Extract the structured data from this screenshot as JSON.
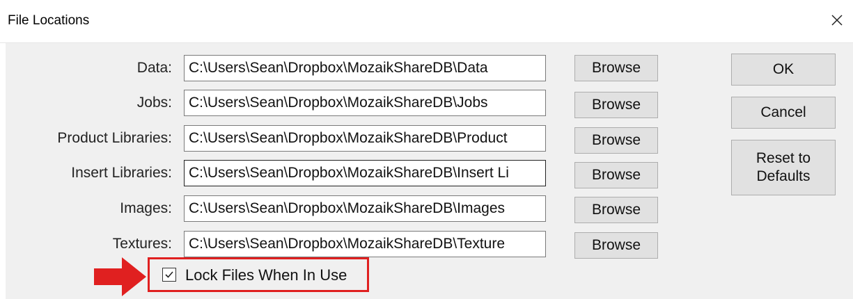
{
  "window": {
    "title": "File Locations"
  },
  "rows": [
    {
      "label": "Data:",
      "path": "C:\\Users\\Sean\\Dropbox\\MozaikShareDB\\Data",
      "browse_label": "Browse"
    },
    {
      "label": "Jobs:",
      "path": "C:\\Users\\Sean\\Dropbox\\MozaikShareDB\\Jobs",
      "browse_label": "Browse"
    },
    {
      "label": "Product Libraries:",
      "path": "C:\\Users\\Sean\\Dropbox\\MozaikShareDB\\Product",
      "browse_label": "Browse"
    },
    {
      "label": "Insert Libraries:",
      "path": "C:\\Users\\Sean\\Dropbox\\MozaikShareDB\\Insert Li",
      "browse_label": "Browse"
    },
    {
      "label": "Images:",
      "path": "C:\\Users\\Sean\\Dropbox\\MozaikShareDB\\Images",
      "browse_label": "Browse"
    },
    {
      "label": "Textures:",
      "path": "C:\\Users\\Sean\\Dropbox\\MozaikShareDB\\Texture",
      "browse_label": "Browse"
    }
  ],
  "actions": {
    "ok_label": "OK",
    "cancel_label": "Cancel",
    "reset_label_line1": "Reset to",
    "reset_label_line2": "Defaults"
  },
  "lock_files": {
    "label": "Lock Files When In Use",
    "checked": true
  },
  "icons": {
    "close": "close-icon",
    "checkmark": "checkmark-icon",
    "arrow": "right-arrow-icon"
  },
  "colors": {
    "highlight": "#e02020",
    "button_face": "#e1e1e1",
    "dialog_bg": "#f0f0f0"
  }
}
